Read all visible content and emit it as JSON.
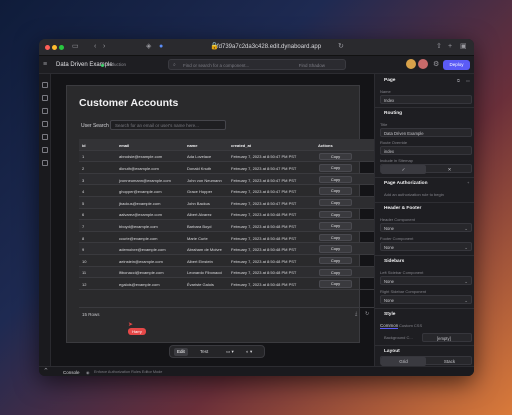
{
  "browser": {
    "url": "fd739a7c2da3c428.edit.dynaboard.app"
  },
  "app": {
    "title": "Data Driven Example",
    "environment": "production",
    "search_placeholder": "Find or search for a component...",
    "search_shortcut": "Find Shadow",
    "deploy_label": "Deploy"
  },
  "page": {
    "title": "Customer Accounts",
    "user_search_label": "User Search",
    "user_search_placeholder": "Search for an email or user's name here...",
    "columns": [
      "id",
      "email",
      "name",
      "created_at",
      "Actions"
    ],
    "rows": [
      {
        "id": "1",
        "email": "abrodsie@example.com",
        "name": "Ada Lovelace",
        "created_at": "February 7, 2023 at 8:50:47 PM PST",
        "action": "Copy"
      },
      {
        "id": "2",
        "email": "dknuth@example.com",
        "name": "Donald Knuth",
        "created_at": "February 7, 2023 at 8:50:47 PM PST",
        "action": "Copy"
      },
      {
        "id": "3",
        "email": "jvonneumann@example.com",
        "name": "John von Neumann",
        "created_at": "February 7, 2023 at 8:50:47 PM PST",
        "action": "Copy"
      },
      {
        "id": "4",
        "email": "ghopper@example.com",
        "name": "Grace Hopper",
        "created_at": "February 7, 2023 at 8:50:47 PM PST",
        "action": "Copy"
      },
      {
        "id": "5",
        "email": "jbackus@example.com",
        "name": "John Backus",
        "created_at": "February 7, 2023 at 8:50:47 PM PST",
        "action": "Copy"
      },
      {
        "id": "6",
        "email": "aalvarez@example.com",
        "name": "Albert Alvarez",
        "created_at": "February 7, 2023 at 8:50:48 PM PST",
        "action": "Copy"
      },
      {
        "id": "7",
        "email": "bboyd@example.com",
        "name": "Barbara Boyd",
        "created_at": "February 7, 2023 at 8:50:48 PM PST",
        "action": "Copy"
      },
      {
        "id": "8",
        "email": "ccurie@example.com",
        "name": "Marie Curie",
        "created_at": "February 7, 2023 at 8:50:48 PM PST",
        "action": "Copy"
      },
      {
        "id": "9",
        "email": "ademoivre@example.com",
        "name": "Abraham de Moivre",
        "created_at": "February 7, 2023 at 8:50:48 PM PST",
        "action": "Copy"
      },
      {
        "id": "10",
        "email": "aeinstein@example.com",
        "name": "Albert Einstein",
        "created_at": "February 7, 2023 at 8:50:48 PM PST",
        "action": "Copy"
      },
      {
        "id": "11",
        "email": "lfibonacci@example.com",
        "name": "Leonardo Fibonacci",
        "created_at": "February 7, 2023 at 8:50:48 PM PST",
        "action": "Copy"
      },
      {
        "id": "12",
        "email": "egalois@example.com",
        "name": "Évariste Galois",
        "created_at": "February 7, 2023 at 8:50:48 PM PST",
        "action": "Copy"
      }
    ],
    "row_count": "15 Rows"
  },
  "cursor_badge": "Harry",
  "toolbar": {
    "edit": "Edit",
    "test": "Test"
  },
  "inspector": {
    "page_label": "Page",
    "name_label": "Name",
    "name_value": "Index",
    "routing_label": "Routing",
    "title_label": "Title",
    "title_value": "Data Driven Example",
    "route_label": "Route Override",
    "route_value": "index",
    "sitemap_label": "Include in Sitemap",
    "page_auth_label": "Page Authorization",
    "page_auth_hint": "Add an authorization rule to begin",
    "header_footer_label": "Header & Footer",
    "header_component_label": "Header Component",
    "header_component_value": "None",
    "footer_component_label": "Footer Component",
    "footer_component_value": "None",
    "sidebars_label": "Sidebars",
    "left_sidebar_label": "Left Sidebar Component",
    "left_sidebar_value": "None",
    "right_sidebar_label": "Right Sidebar Component",
    "right_sidebar_value": "None",
    "style_label": "Style",
    "style_tab_common": "Common",
    "style_tab_css": "Custom CSS",
    "background_label": "Background C...",
    "background_value": "[empty]",
    "layout_label": "Layout",
    "layout_grid": "Grid",
    "layout_stack": "Stack"
  },
  "console": {
    "label": "Console",
    "sub": "Enforce Authorization Rules Editor Mode"
  },
  "colors": {
    "accent": "#5b5bf6",
    "env_status": "#3ccf6a",
    "badge": "#e54848"
  }
}
